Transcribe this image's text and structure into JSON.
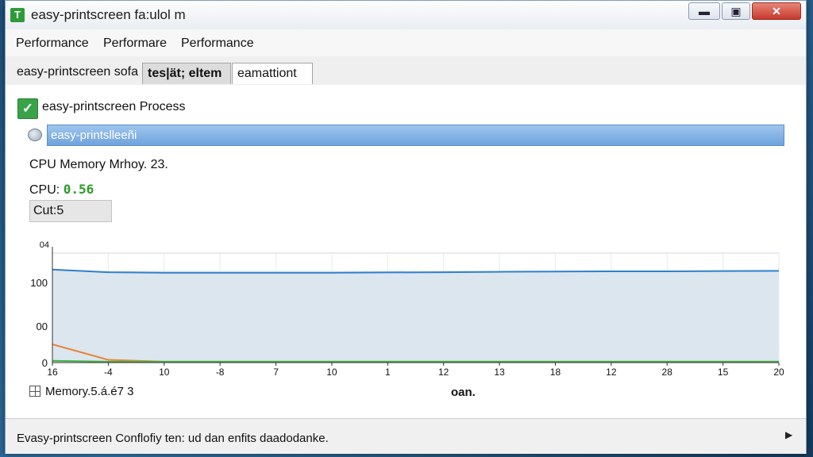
{
  "window": {
    "title": "easy-printscreen fa:ulol m",
    "app_icon_glyph": "T",
    "controls": {
      "minimize": "▬",
      "maximize": "▣",
      "close": "✕"
    }
  },
  "menu": [
    "Performance",
    "Performare",
    "Performance"
  ],
  "tabs": {
    "label": "easy-printscreen sofa",
    "items": [
      "tes|ät; eltem",
      "eamattiont"
    ]
  },
  "process": {
    "title": "easy-printscreen Process",
    "selected": "easy-printslleeñi",
    "memory_line": "CPU Memory Mrhoy. 23.",
    "cpu_label": "CPU:",
    "cpu_value": "0.56",
    "cut": "Cut:5"
  },
  "graph_labels": {
    "corner": "04",
    "memory": "Memory.5.á.é7 3",
    "unit": "oan."
  },
  "chart_data": {
    "type": "line",
    "x": [
      "16",
      "-4",
      "10",
      "-8",
      "7",
      "10",
      "1",
      "12",
      "13",
      "18",
      "12",
      "28",
      "15",
      "20"
    ],
    "ylim": [
      0,
      120
    ],
    "y_tick_labels": [
      "0",
      "00",
      "100"
    ],
    "grid": true,
    "series": [
      {
        "color": "#2f7fd0",
        "fill": "#dbe6ee",
        "values": [
          102,
          99,
          98.5,
          98.5,
          98.5,
          98.5,
          98.8,
          99,
          99.5,
          99.8,
          100,
          100,
          100.3,
          100.5
        ]
      },
      {
        "color": "#e8843a",
        "values": [
          20,
          3,
          1,
          1,
          1,
          1,
          1,
          1,
          1,
          1,
          1,
          1,
          1,
          1
        ]
      },
      {
        "color": "#45b045",
        "values": [
          2,
          1,
          1,
          1,
          1,
          1,
          1,
          1,
          1,
          1,
          1,
          1,
          1,
          1
        ]
      }
    ]
  },
  "statusbar": {
    "text": "Evasy-printscreen Conflofiy ten: ud dan enfits daadodanke.",
    "arrow": "▶"
  }
}
